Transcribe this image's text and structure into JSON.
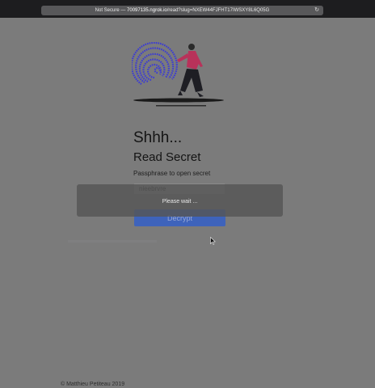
{
  "browser": {
    "address_prefix": "Not Secure — ",
    "address_domain": "70097135.ngrok.io",
    "address_path": "/read?slug=NXEW44FJFHT17IWSXY8L6Q05G"
  },
  "illustration": {
    "icon": "fingerprint-woman-illustration"
  },
  "main": {
    "title": "Shhh...",
    "subtitle": "Read Secret",
    "passphrase_label": "Passphrase to open secret",
    "passphrase_value": "nieebrvre",
    "decrypt_label": "Decrypt"
  },
  "overlay": {
    "message": "Please wait ..."
  },
  "footer": {
    "text": "© Matthieu Petiteau 2019"
  },
  "colors": {
    "button": "#3e63bb",
    "page_background": "#7b7b7b",
    "fingerprint": "#3b3bd4",
    "accent_top": "#b8325a"
  }
}
